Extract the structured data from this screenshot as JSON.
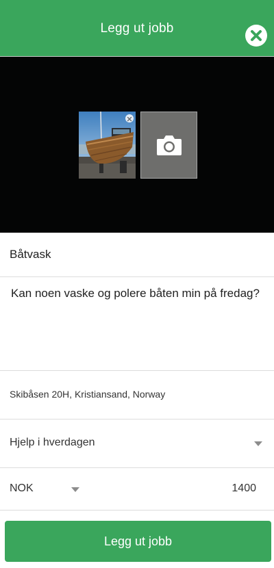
{
  "header": {
    "title": "Legg ut jobb",
    "close_icon": "close-circle-icon",
    "accent_color": "#3aa65c"
  },
  "media": {
    "background": "#040505",
    "photos": [
      {
        "subject": "wooden boat photo",
        "remove_icon": "close-icon"
      }
    ],
    "add_photo_icon": "camera-icon"
  },
  "form": {
    "title_value": "Båtvask",
    "description_value": "Kan noen vaske og polere båten min på fredag?",
    "address_value": "Skibåsen 20H, Kristiansand, Norway",
    "category_value": "Hjelp i hverdagen",
    "currency_value": "NOK",
    "price_value": "1400"
  },
  "submit": {
    "label": "Legg ut jobb"
  }
}
